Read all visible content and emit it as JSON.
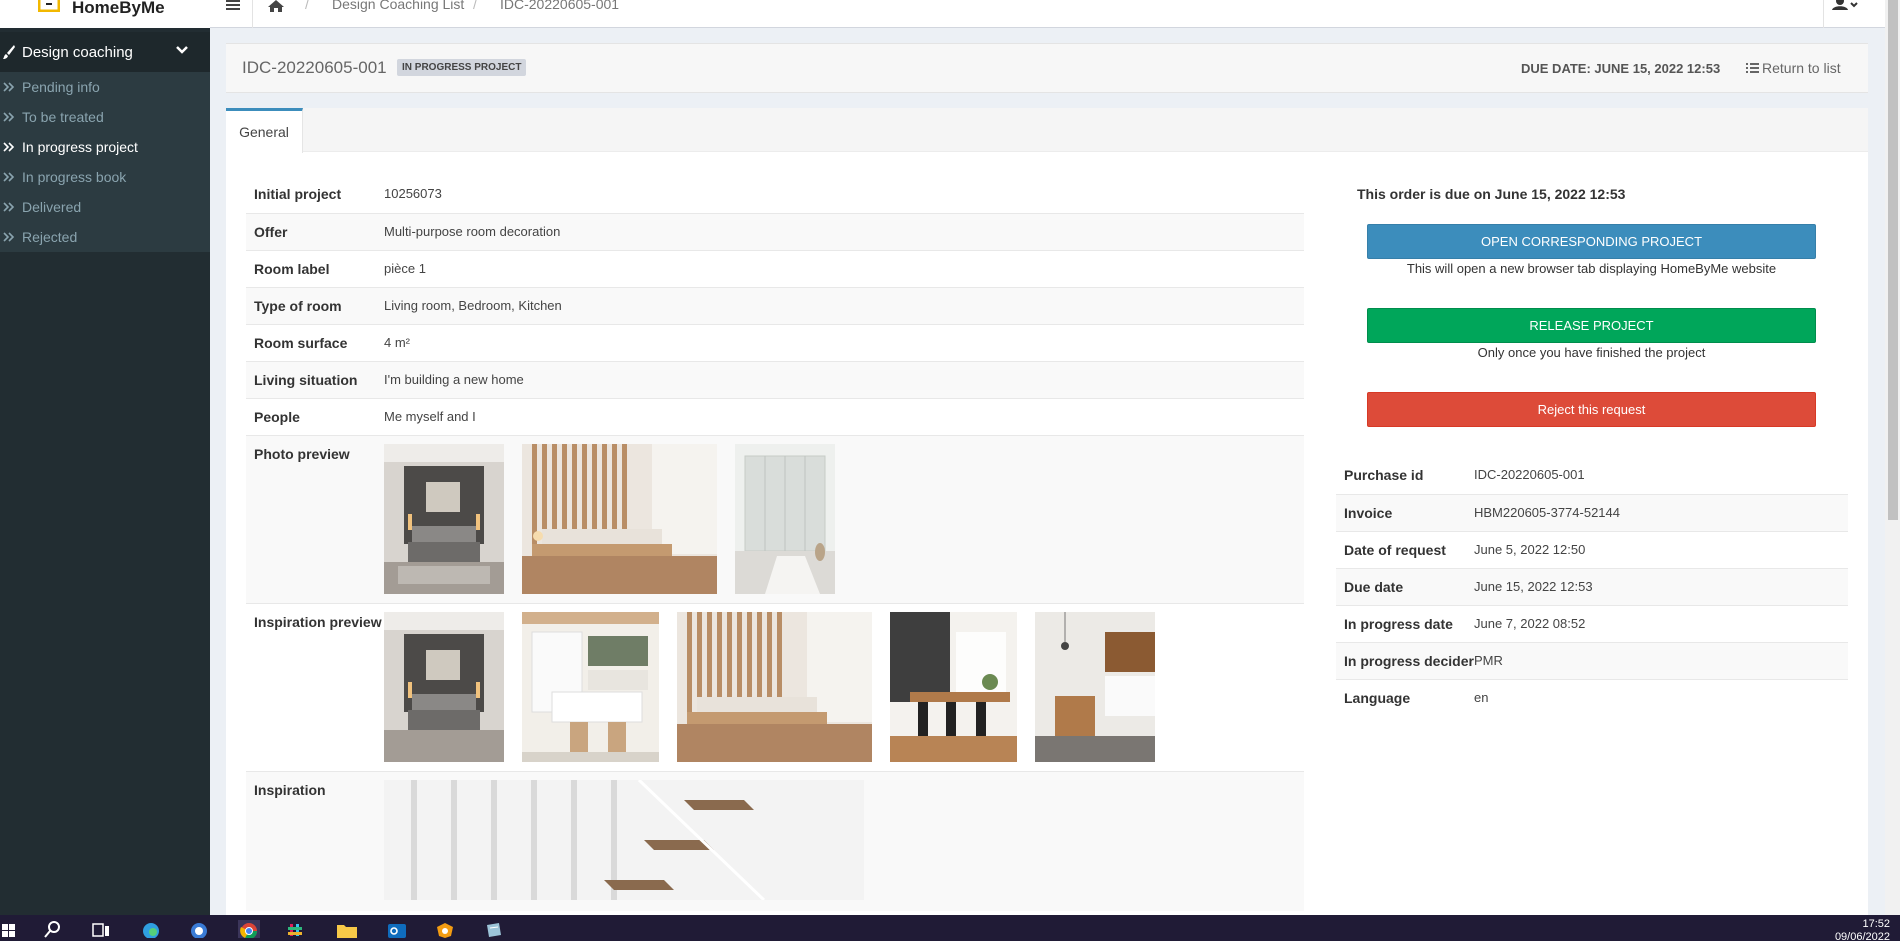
{
  "app": {
    "logo_text": "HomeByMe"
  },
  "sidebar": {
    "section_label": "Design coaching",
    "items": [
      {
        "label": "Pending info",
        "active": false
      },
      {
        "label": "To be treated",
        "active": false
      },
      {
        "label": "In progress project",
        "active": true
      },
      {
        "label": "In progress book",
        "active": false
      },
      {
        "label": "Delivered",
        "active": false
      },
      {
        "label": "Rejected",
        "active": false
      }
    ]
  },
  "breadcrumb": {
    "items": [
      "Design Coaching List",
      "IDC-20220605-001"
    ]
  },
  "header": {
    "project_id": "IDC-20220605-001",
    "status_badge": "IN PROGRESS PROJECT",
    "due_date": "DUE DATE: JUNE 15, 2022 12:53",
    "return_label": "Return to list"
  },
  "tabs": [
    {
      "label": "General"
    }
  ],
  "details": {
    "initial_project": {
      "label": "Initial project",
      "value": "10256073"
    },
    "offer": {
      "label": "Offer",
      "value": "Multi-purpose room decoration"
    },
    "room_label": {
      "label": "Room label",
      "value": "pièce 1"
    },
    "room_type": {
      "label": "Type of room",
      "value": "Living room, Bedroom, Kitchen"
    },
    "room_surface": {
      "label": "Room surface",
      "value": "4 m²"
    },
    "living_situation": {
      "label": "Living situation",
      "value": "I'm building a new home"
    },
    "people": {
      "label": "People",
      "value": "Me myself and I"
    },
    "photo_preview": {
      "label": "Photo preview"
    },
    "inspiration_preview": {
      "label": "Inspiration preview"
    },
    "inspiration": {
      "label": "Inspiration"
    }
  },
  "actions": {
    "due_message": "This order is due on June 15, 2022 12:53",
    "open_label": "OPEN CORRESPONDING PROJECT",
    "open_note": "This will open a new browser tab displaying HomeByMe website",
    "release_label": "RELEASE PROJECT",
    "release_note": "Only once you have finished the project",
    "reject_label": "Reject this request"
  },
  "info": {
    "purchase_id": {
      "label": "Purchase id",
      "value": "IDC-20220605-001"
    },
    "invoice": {
      "label": "Invoice",
      "value": "HBM220605-3774-52144"
    },
    "date_of_request": {
      "label": "Date of request",
      "value": "June 5, 2022 12:50"
    },
    "due_date": {
      "label": "Due date",
      "value": "June 15, 2022 12:53"
    },
    "in_progress_date": {
      "label": "In progress date",
      "value": "June 7, 2022 08:52"
    },
    "in_progress_decider": {
      "label": "In progress decider",
      "value": "PMR"
    },
    "language": {
      "label": "Language",
      "value": "en"
    }
  },
  "taskbar": {
    "time": "17:52",
    "date": "09/06/2022"
  },
  "colors": {
    "primary": "#3c8dbc",
    "success": "#00a65a",
    "danger": "#dd4b39",
    "sidebar": "#222d32",
    "logo_accent": "#f2b800"
  }
}
